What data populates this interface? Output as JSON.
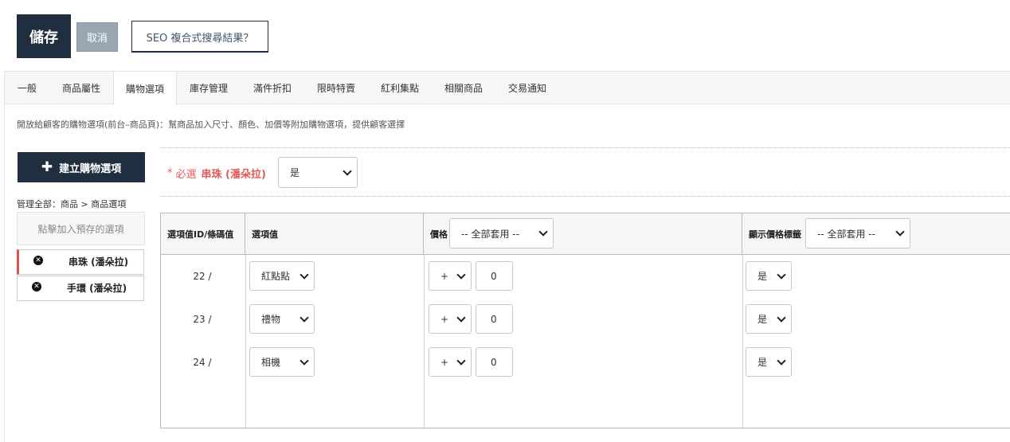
{
  "toolbar": {
    "save_label": "儲存",
    "cancel_label": "取消",
    "seo_label": "SEO 複合式搜尋結果？"
  },
  "tabs": [
    {
      "label": "一般"
    },
    {
      "label": "商品屬性"
    },
    {
      "label": "購物選項",
      "active": true
    },
    {
      "label": "庫存管理"
    },
    {
      "label": "滿件折扣"
    },
    {
      "label": "限時特賣"
    },
    {
      "label": "紅利集點"
    },
    {
      "label": "相關商品"
    },
    {
      "label": "交易通知"
    }
  ],
  "description": "開放給顧客的購物選項(前台–商品頁)：幫商品加入尺寸、顏色、加價等附加購物選項，提供顧客選擇",
  "sidebar": {
    "create_label": "建立購物選項",
    "create_icon": "plus-icon",
    "breadcrumb": "管理全部：商品 > 商品選項",
    "preset_label": "點擊加入預存的選項",
    "items": [
      {
        "label": "串珠 (潘朵拉)",
        "active": true
      },
      {
        "label": "手環 (潘朵拉)",
        "active": false
      }
    ]
  },
  "option": {
    "required_star": "*",
    "required_text": "必選",
    "name": "串珠 (潘朵拉)",
    "required_value": "是"
  },
  "table": {
    "headers": {
      "id": "選項值ID/條碼值",
      "value": "選項值",
      "price": "價格",
      "price_apply": "-- 全部套用 --",
      "show_price": "顯示價格標籤",
      "show_apply": "-- 全部套用 --"
    },
    "rows": [
      {
        "id": "22 /",
        "value": "紅點點",
        "sign": "+",
        "price": "0",
        "show": "是"
      },
      {
        "id": "23 /",
        "value": "禮物",
        "sign": "+",
        "price": "0",
        "show": "是"
      },
      {
        "id": "24 /",
        "value": "相機",
        "sign": "+",
        "price": "0",
        "show": "是"
      }
    ]
  }
}
